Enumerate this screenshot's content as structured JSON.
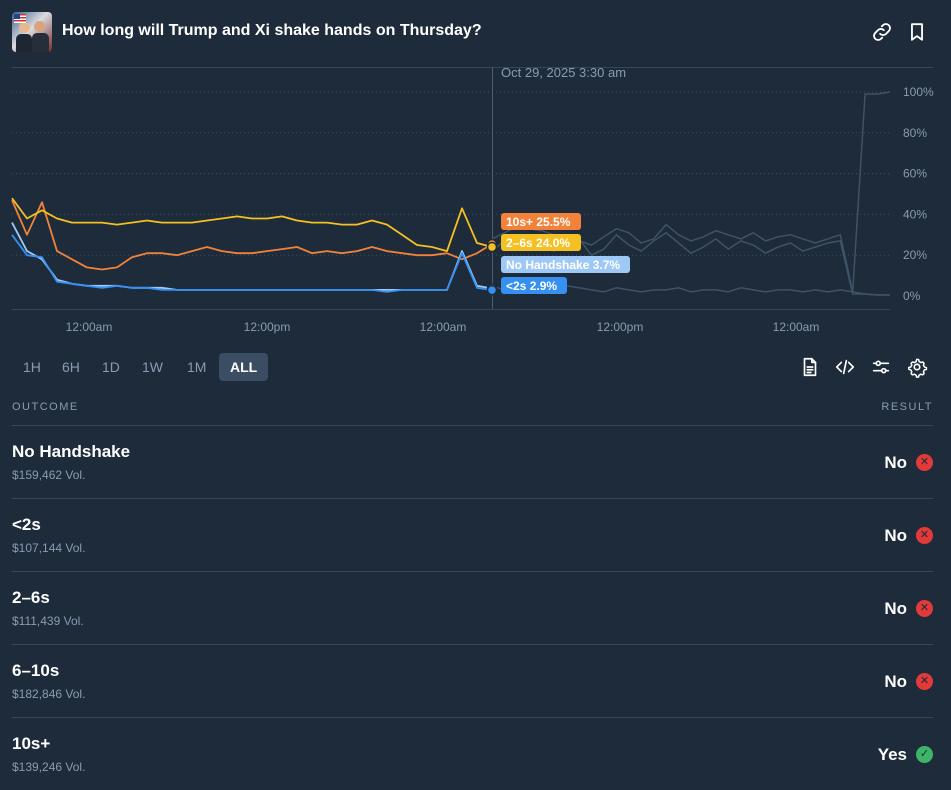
{
  "header": {
    "title": "How long will Trump and Xi shake hands on Thursday?",
    "thumbnail_icon": "market-thumbnail",
    "link_icon": "link-icon",
    "bookmark_icon": "bookmark-icon"
  },
  "chart_data": {
    "type": "line",
    "hover_timestamp": "Oct 29, 2025 3:30 am",
    "x_ticks": [
      "12:00am",
      "12:00pm",
      "12:00am",
      "12:00pm",
      "12:00am"
    ],
    "y_ticks": [
      "100%",
      "80%",
      "60%",
      "40%",
      "20%",
      "0%"
    ],
    "ylim": [
      0,
      100
    ],
    "grid": true,
    "series": [
      {
        "name": "10s+",
        "label": "10s+ 25.5%",
        "color": "#f2823a",
        "values": [
          47,
          30,
          46,
          22,
          18,
          14,
          13,
          14,
          19,
          21,
          21,
          20,
          22,
          24,
          22,
          21,
          21,
          22,
          23,
          24,
          21,
          22,
          21,
          22,
          24,
          22,
          21,
          20,
          20,
          21,
          18,
          21,
          25.5
        ]
      },
      {
        "name": "2-6s",
        "label": "2–6s 24.0%",
        "color": "#f5c021",
        "values": [
          48,
          38,
          42,
          38,
          36,
          36,
          36,
          35,
          36,
          37,
          36,
          36,
          36,
          37,
          38,
          39,
          38,
          38,
          39,
          37,
          36,
          36,
          35,
          35,
          37,
          35,
          30,
          25,
          24,
          22,
          43,
          26,
          24
        ]
      },
      {
        "name": "No Handshake",
        "label": "No Handshake 3.7%",
        "color": "#9ec9f6",
        "values": [
          36,
          22,
          18,
          8,
          6,
          5,
          5,
          5,
          4,
          4,
          4,
          3,
          3,
          3,
          3,
          3,
          3,
          3,
          3,
          3,
          3,
          3,
          3,
          3,
          3,
          3,
          3,
          3,
          3,
          3,
          22,
          5,
          3.7
        ]
      },
      {
        "name": "<2s",
        "label": "<2s 2.9%",
        "color": "#3590f0",
        "values": [
          30,
          20,
          19,
          7,
          6,
          5,
          4,
          5,
          4,
          4,
          3,
          3,
          3,
          3,
          3,
          3,
          3,
          3,
          3,
          3,
          3,
          3,
          3,
          3,
          3,
          2,
          3,
          3,
          3,
          3,
          21,
          4,
          2.9
        ]
      }
    ],
    "future_series": [
      {
        "values": [
          28,
          31,
          34,
          33,
          32,
          30,
          28,
          27,
          25,
          29,
          33,
          31,
          26,
          28,
          35,
          30,
          27,
          29,
          32,
          30,
          28,
          31,
          27,
          29,
          30,
          28,
          26,
          28,
          30,
          2,
          1,
          0.5,
          0.5
        ]
      },
      {
        "values": [
          22,
          27,
          29,
          26,
          24,
          22,
          25,
          28,
          20,
          23,
          30,
          25,
          22,
          27,
          31,
          26,
          21,
          24,
          28,
          23,
          27,
          25,
          21,
          24,
          26,
          22,
          24,
          26,
          27,
          1,
          1,
          0.5,
          0.5
        ]
      },
      {
        "values": [
          5,
          3,
          4,
          2,
          3,
          3,
          5,
          4,
          3,
          2,
          4,
          3,
          2,
          3,
          3,
          4,
          2,
          3,
          3,
          2,
          4,
          3,
          2,
          3,
          3,
          2,
          3,
          2,
          3,
          2,
          99,
          99,
          100
        ]
      }
    ]
  },
  "range_buttons": [
    "1H",
    "6H",
    "1D",
    "1W",
    "1M",
    "ALL"
  ],
  "active_range": "ALL",
  "tools": [
    "document-icon",
    "code-icon",
    "sliders-icon",
    "settings-icon"
  ],
  "outcome_header": "OUTCOME",
  "result_header": "RESULT",
  "outcomes": [
    {
      "name": "No Handshake",
      "volume": "$159,462 Vol.",
      "result": "No",
      "result_icon": "x-circle-icon",
      "result_color": "#e23939"
    },
    {
      "name": "<2s",
      "volume": "$107,144 Vol.",
      "result": "No",
      "result_icon": "x-circle-icon",
      "result_color": "#e23939"
    },
    {
      "name": "2–6s",
      "volume": "$111,439 Vol.",
      "result": "No",
      "result_icon": "x-circle-icon",
      "result_color": "#e23939"
    },
    {
      "name": "6–10s",
      "volume": "$182,846 Vol.",
      "result": "No",
      "result_icon": "x-circle-icon",
      "result_color": "#e23939"
    },
    {
      "name": "10s+",
      "volume": "$139,246 Vol.",
      "result": "Yes",
      "result_icon": "check-circle-icon",
      "result_color": "#3db468"
    }
  ]
}
